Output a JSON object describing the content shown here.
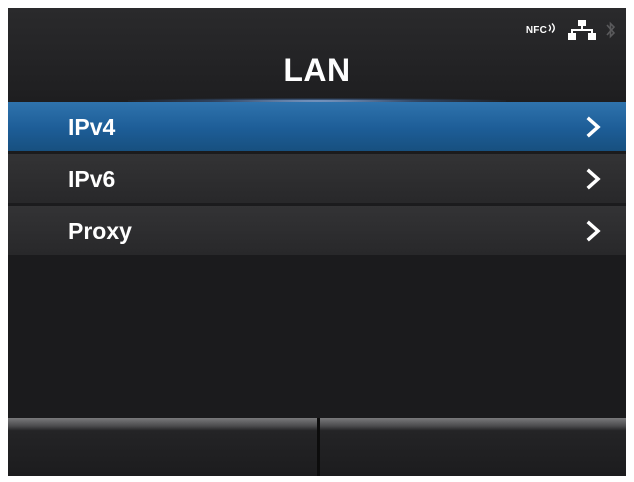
{
  "header": {
    "title": "LAN",
    "status_icons": {
      "nfc_text": "NFC",
      "nfc_icon": "nfc-icon",
      "network_icon": "wired-network-icon",
      "bluetooth_icon": "bluetooth-icon"
    }
  },
  "menu": {
    "items": [
      {
        "label": "IPv4",
        "selected": true,
        "icon": "chevron-right-icon"
      },
      {
        "label": "IPv6",
        "selected": false,
        "icon": "chevron-right-icon"
      },
      {
        "label": "Proxy",
        "selected": false,
        "icon": "chevron-right-icon"
      }
    ]
  },
  "softkeys": {
    "left_label": "",
    "right_label": ""
  },
  "colors": {
    "selected_row": "#1d5d97",
    "row": "#2e2e30",
    "background": "#1b1b1d",
    "text": "#ffffff"
  }
}
